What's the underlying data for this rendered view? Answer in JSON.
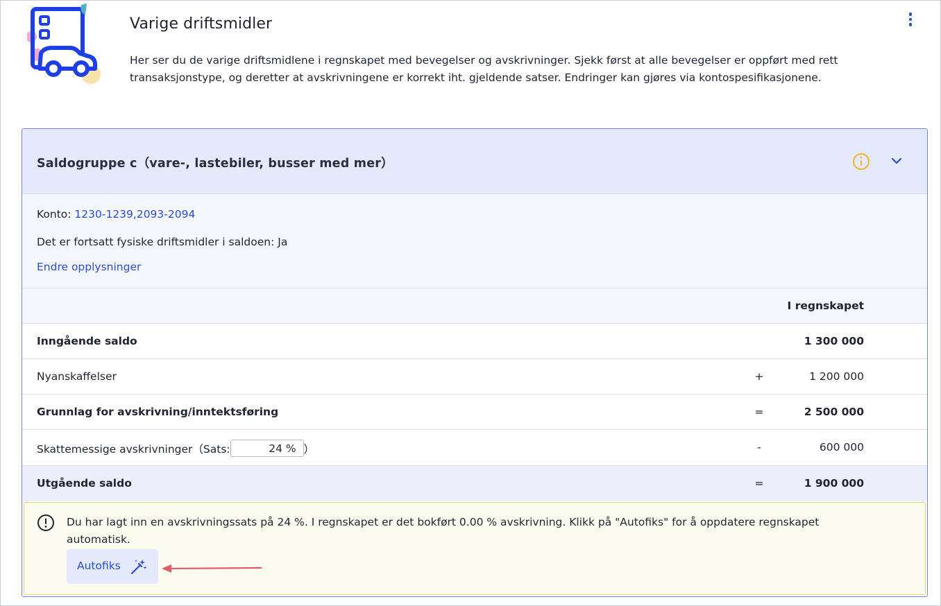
{
  "page": {
    "title": "Varige driftsmidler",
    "description": "Her ser du de varige driftsmidlene i regnskapet med bevegelser og avskrivninger. Sjekk først at alle bevegelser er oppført med rett transaksjonstype, og deretter at avskrivningene er korrekt iht. gjeldende satser. Endringer kan gjøres via kontospesifikasjonene."
  },
  "icons": {
    "illustration": "car-building-illustration-icon",
    "menu": "more-vertical-icon",
    "info": "info-circle-icon",
    "expand": "chevron-down-icon",
    "warning": "exclamation-circle-icon",
    "autofix": "magic-wand-icon",
    "annotation": "red-arrow-annotation"
  },
  "group": {
    "title": "Saldogruppe c（vare-, lastebiler, busser med mer）",
    "konto_label": "Konto:",
    "konto_value": "1230-1239,2093-2094",
    "physical_assets": "Det er fortsatt fysiske driftsmidler i saldoen: Ja",
    "edit_link": "Endre opplysninger"
  },
  "table": {
    "column_header": "I regnskapet",
    "rows": [
      {
        "label": "Inngående saldo",
        "operator": "",
        "value": "1 300 000"
      },
      {
        "label": "Nyanskaffelser",
        "operator": "+",
        "value": "1 200 000"
      },
      {
        "label": "Grunnlag for avskrivning/inntektsføring",
        "operator": "=",
        "value": "2 500 000"
      },
      {
        "label_before": "Skattemessige avskrivninger（Sats:",
        "rate": "24 %",
        "label_after": "）",
        "operator": "-",
        "value": "600 000"
      },
      {
        "label": "Utgående saldo",
        "operator": "=",
        "value": "1 900 000"
      }
    ]
  },
  "warning": {
    "text": "Du har lagt inn en avskrivningssats på 24 %. I regnskapet er det bokført 0.00 % avskrivning. Klikk på \"Autofiks\" for å oppdatere regnskapet automatisk.",
    "button_label": "Autofiks"
  },
  "colors": {
    "accent": "#2a4bd7",
    "header_bg": "#e4e9fb",
    "warning_bg": "#fcfbf0",
    "warning_border": "#e6d27a",
    "info_icon": "#f0b429",
    "annotation_arrow": "#e05a6a"
  }
}
